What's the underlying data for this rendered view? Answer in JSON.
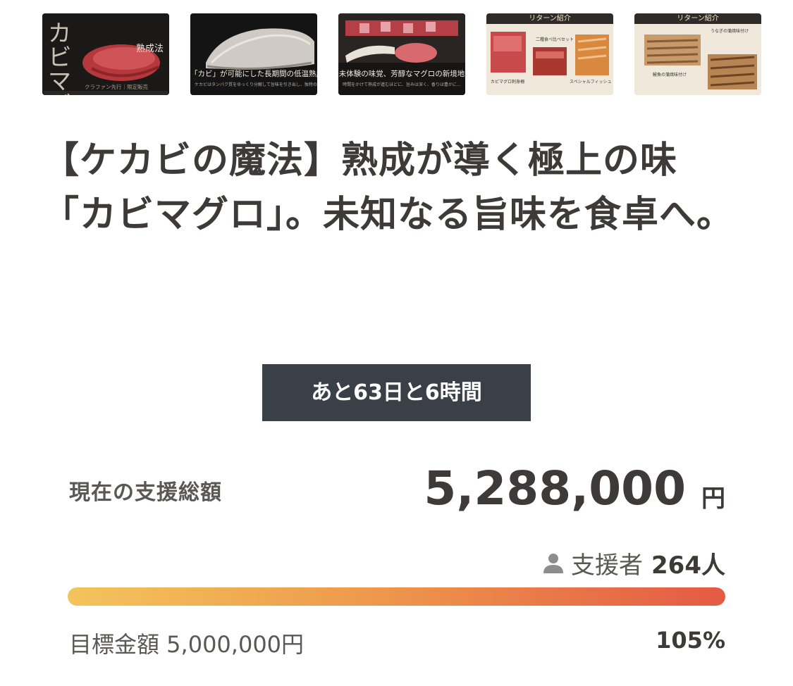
{
  "gallery": {
    "thumb1": {
      "side_text": "…",
      "caption_main": "熟成法",
      "caption_sub": "クラファン先行｜限定販売",
      "logo_text": "カビマグロ"
    },
    "thumb2": {
      "caption": "「カビ」が可能にした長期間の低温熟成",
      "caption_sub": "ケカビはタンパク質をゆっくり分解して旨味を引き出し、独特の香りを…"
    },
    "thumb3": {
      "caption": "未体験の味覚、芳醇なマグロの新境地",
      "caption_sub": "時間をかけて熟成が進むほどに、旨みは深く、香りは豊かに…"
    },
    "thumb4": {
      "header": "リターン紹介",
      "label_a": "カビマグロ刺身柵",
      "label_b": "二種食べ比べセット",
      "label_c": "スペシャルフィッシュ"
    },
    "thumb5": {
      "header": "リターン紹介",
      "label_a": "うなぎの蒲焼味付け",
      "label_b": "鰻魚の蒲焼味付け"
    }
  },
  "project": {
    "title": "【ケカビの魔法】熟成が導く極上の味「カビマグロ」。未知なる旨味を食卓へ。"
  },
  "countdown": {
    "label": "あと63日と6時間"
  },
  "funding": {
    "total_label": "現在の支援総額",
    "total_amount": "5,288,000",
    "currency_unit": "円",
    "backers_label": "支援者",
    "backers_count": "264人",
    "goal_text": "目標金額 5,000,000円",
    "percent_text": "105%",
    "progress_fraction": 1.0
  },
  "colors": {
    "countdown_bg": "#3b3f47",
    "progress_start": "#f3c45c",
    "progress_end": "#e45a44",
    "text": "#3e3a39"
  },
  "icons": {
    "backers": "person-icon"
  }
}
